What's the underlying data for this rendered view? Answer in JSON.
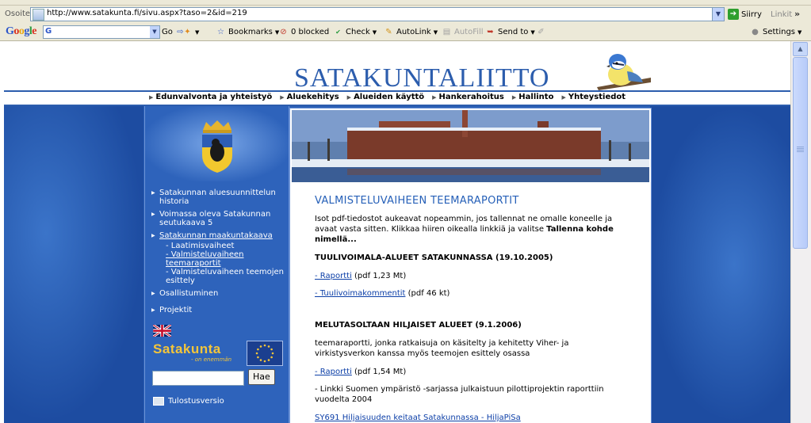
{
  "browser": {
    "address_label": "Osoite",
    "url": "http://www.satakunta.fi/sivu.aspx?taso=2&id=219",
    "go_label": "Siirry",
    "links_label": "Linkit",
    "more": "»"
  },
  "google_toolbar": {
    "logo": [
      "G",
      "o",
      "o",
      "g",
      "l",
      "e"
    ],
    "search_prefix": "G",
    "go": "Go",
    "bookmarks": "Bookmarks",
    "blocked": "0 blocked",
    "check": "Check",
    "autolink": "AutoLink",
    "autofill": "AutoFill",
    "send_to": "Send to",
    "settings": "Settings"
  },
  "site": {
    "title": "SATAKUNTALIITTO",
    "nav": [
      "Edunvalvonta ja yhteistyö",
      "Aluekehitys",
      "Alueiden käyttö",
      "Hankerahoitus",
      "Hallinto",
      "Yhteystiedot"
    ]
  },
  "sidebar": {
    "items": [
      {
        "label": "Satakunnan aluesuunnittelun historia"
      },
      {
        "label": "Voimassa oleva Satakunnan seutukaava 5"
      },
      {
        "label": "Satakunnan maakuntakaava"
      }
    ],
    "subitems": [
      "- Laatimisvaiheet",
      "- Valmisteluvaiheen teemaraportit",
      "- Valmisteluvaiheen teemojen esittely"
    ],
    "items2": [
      {
        "label": "Osallistuminen"
      },
      {
        "label": "Projektit"
      }
    ],
    "brand": "Satakunta",
    "brand_sub": "- on enemmän",
    "search_button": "Hae",
    "print_label": "Tulostusversio"
  },
  "content": {
    "heading": "VALMISTELUVAIHEEN TEEMARAPORTIT",
    "intro_1": "Isot pdf-tiedostot aukeavat nopeammin, jos tallennat ne omalle koneelle ja avaat vasta sitten. Klikkaa hiiren oikealla linkkiä ja valitse ",
    "intro_bold": "Tallenna kohde nimellä...",
    "section1": {
      "title": "TUULIVOIMALA-ALUEET SATAKUNNASSA (19.10.2005)",
      "link1": "- Raportti",
      "size1": "(pdf 1,23 Mt)",
      "link2": "- Tuulivoimakommentit",
      "size2": "(pdf 46 kt)"
    },
    "section2": {
      "title": "MELUTASOLTAAN HILJAISET ALUEET (9.1.2006)",
      "desc": "teemaraportti, jonka ratkaisuja on käsitelty ja kehitetty Viher- ja virkistysverkon kanssa myös teemojen esittely osassa",
      "link1": "- Raportti",
      "size1": "(pdf 1,54 Mt)",
      "note": "- Linkki Suomen ympäristö -sarjassa julkaistuun pilottiprojektin raporttiin vuodelta 2004",
      "link2": "SY691 Hiljaisuuden keitaat Satakunnassa - HiljaPiSa"
    }
  },
  "colors": {
    "brand_blue": "#2c5dad",
    "sidebar_blue": "#2e63bb",
    "link": "#0b3ea7",
    "heading": "#2660b8",
    "brand_gold": "#f3c53a"
  }
}
